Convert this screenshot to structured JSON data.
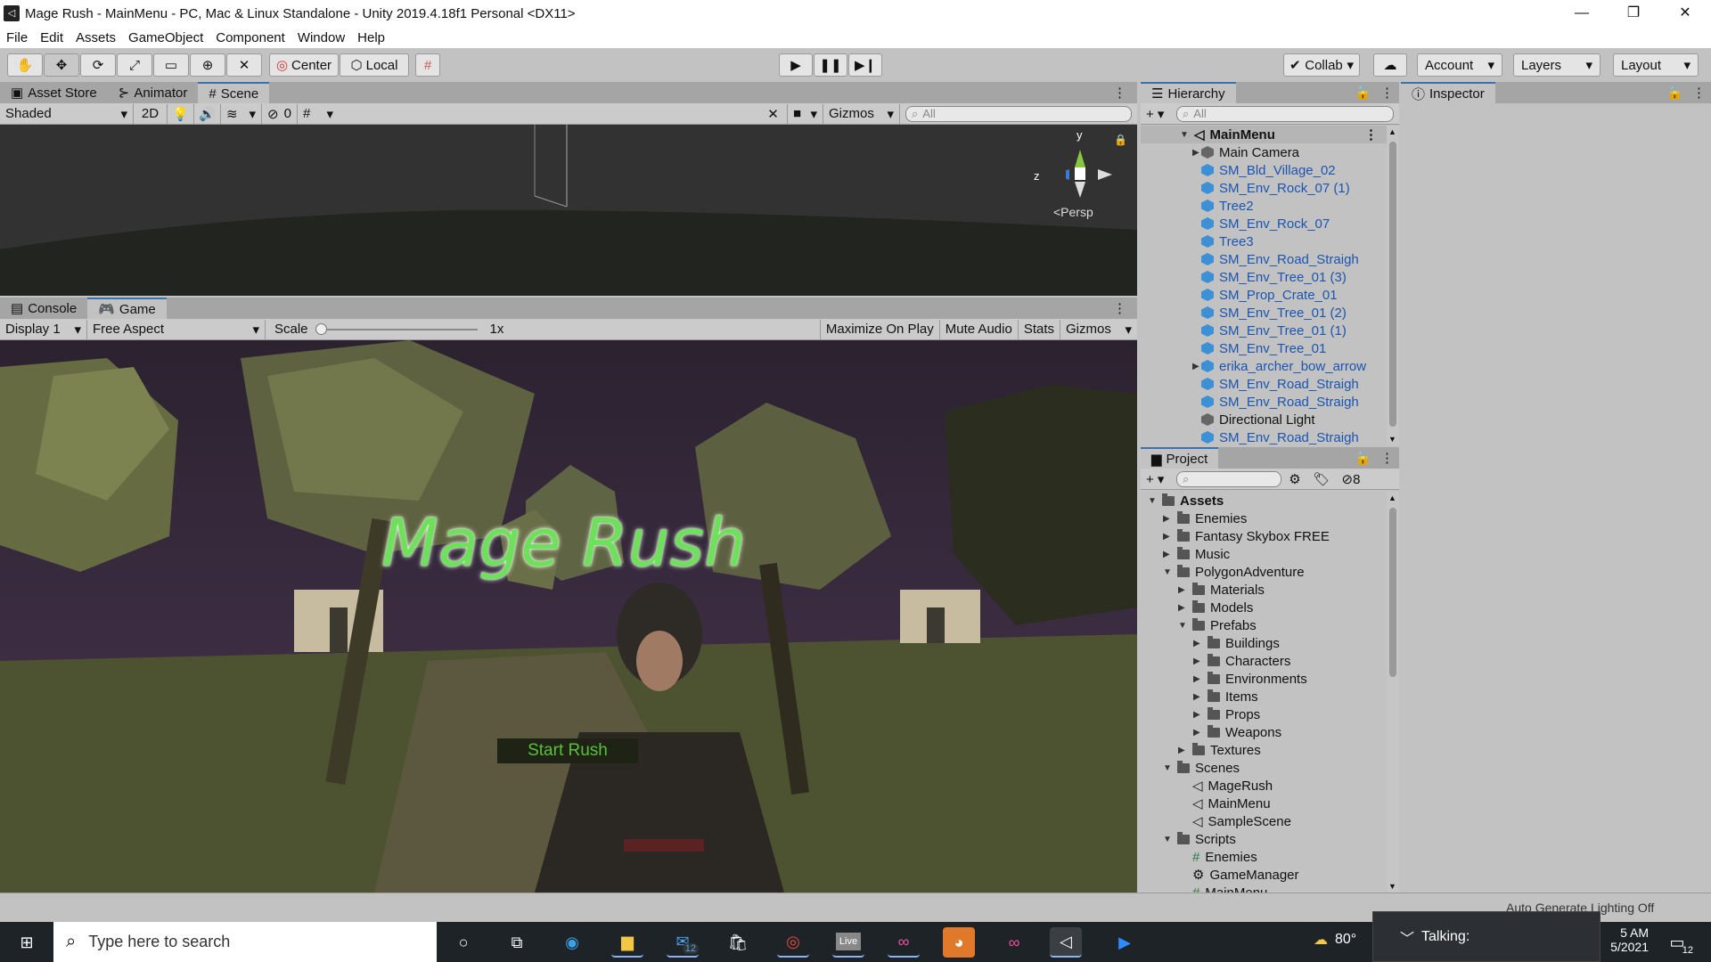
{
  "window": {
    "title": "Mage Rush - MainMenu - PC, Mac & Linux Standalone - Unity 2019.4.18f1 Personal <DX11>",
    "minimize": "—",
    "maximize": "❐",
    "close": "✕"
  },
  "menu": [
    "File",
    "Edit",
    "Assets",
    "GameObject",
    "Component",
    "Window",
    "Help"
  ],
  "toolbar": {
    "center_label": "Center",
    "local_label": "Local",
    "collab_label": "Collab",
    "account_label": "Account",
    "layers_label": "Layers",
    "layout_label": "Layout"
  },
  "scene_panel": {
    "tabs": [
      "Asset Store",
      "Animator",
      "Scene"
    ],
    "shading": "Shaded",
    "mode_2d": "2D",
    "hidden_count": "0",
    "gizmos": "Gizmos",
    "search_placeholder": "All",
    "persp": "<Persp",
    "axis_y": "y",
    "axis_z": "z"
  },
  "game_panel": {
    "tabs": [
      "Console",
      "Game"
    ],
    "display": "Display 1",
    "aspect": "Free Aspect",
    "scale_label": "Scale",
    "scale_value": "1x",
    "maximize_on_play": "Maximize On Play",
    "mute_audio": "Mute Audio",
    "stats": "Stats",
    "gizmos": "Gizmos",
    "game_title": "Mage Rush",
    "start_button": "Start Rush"
  },
  "hierarchy": {
    "tab": "Hierarchy",
    "search_placeholder": "All",
    "scene": "MainMenu",
    "items": [
      {
        "name": "Main Camera",
        "type": "grey"
      },
      {
        "name": "SM_Bld_Village_02",
        "type": "prefab"
      },
      {
        "name": "SM_Env_Rock_07 (1)",
        "type": "prefab"
      },
      {
        "name": "Tree2",
        "type": "prefab"
      },
      {
        "name": "SM_Env_Rock_07",
        "type": "prefab"
      },
      {
        "name": "Tree3",
        "type": "prefab"
      },
      {
        "name": "SM_Env_Road_Straigh",
        "type": "prefab"
      },
      {
        "name": "SM_Env_Tree_01 (3)",
        "type": "prefab"
      },
      {
        "name": "SM_Prop_Crate_01",
        "type": "prefab"
      },
      {
        "name": "SM_Env_Tree_01 (2)",
        "type": "prefab"
      },
      {
        "name": "SM_Env_Tree_01 (1)",
        "type": "prefab"
      },
      {
        "name": "SM_Env_Tree_01",
        "type": "prefab"
      },
      {
        "name": "erika_archer_bow_arrow",
        "type": "prefab"
      },
      {
        "name": "SM_Env_Road_Straigh",
        "type": "prefab"
      },
      {
        "name": "SM_Env_Road_Straigh",
        "type": "prefab"
      },
      {
        "name": "Directional Light",
        "type": "grey"
      },
      {
        "name": "SM_Env_Road_Straigh",
        "type": "prefab"
      }
    ]
  },
  "inspector": {
    "tab": "Inspector"
  },
  "project": {
    "tab": "Project",
    "hidden_count": "8",
    "tree": [
      {
        "label": "Assets",
        "depth": 0,
        "open": true,
        "kind": "folder",
        "bold": true
      },
      {
        "label": "Enemies",
        "depth": 1,
        "open": false,
        "kind": "folder"
      },
      {
        "label": "Fantasy Skybox FREE",
        "depth": 1,
        "open": false,
        "kind": "folder"
      },
      {
        "label": "Music",
        "depth": 1,
        "open": false,
        "kind": "folder"
      },
      {
        "label": "PolygonAdventure",
        "depth": 1,
        "open": true,
        "kind": "folder"
      },
      {
        "label": "Materials",
        "depth": 2,
        "open": false,
        "kind": "folder"
      },
      {
        "label": "Models",
        "depth": 2,
        "open": false,
        "kind": "folder"
      },
      {
        "label": "Prefabs",
        "depth": 2,
        "open": true,
        "kind": "folder"
      },
      {
        "label": "Buildings",
        "depth": 3,
        "open": false,
        "kind": "folder"
      },
      {
        "label": "Characters",
        "depth": 3,
        "open": false,
        "kind": "folder"
      },
      {
        "label": "Environments",
        "depth": 3,
        "open": false,
        "kind": "folder"
      },
      {
        "label": "Items",
        "depth": 3,
        "open": false,
        "kind": "folder"
      },
      {
        "label": "Props",
        "depth": 3,
        "open": false,
        "kind": "folder"
      },
      {
        "label": "Weapons",
        "depth": 3,
        "open": false,
        "kind": "folder"
      },
      {
        "label": "Textures",
        "depth": 2,
        "open": false,
        "kind": "folder"
      },
      {
        "label": "Scenes",
        "depth": 1,
        "open": true,
        "kind": "folder"
      },
      {
        "label": "MageRush",
        "depth": 2,
        "open": null,
        "kind": "scene"
      },
      {
        "label": "MainMenu",
        "depth": 2,
        "open": null,
        "kind": "scene"
      },
      {
        "label": "SampleScene",
        "depth": 2,
        "open": null,
        "kind": "scene"
      },
      {
        "label": "Scripts",
        "depth": 1,
        "open": true,
        "kind": "folder"
      },
      {
        "label": "Enemies",
        "depth": 2,
        "open": null,
        "kind": "script"
      },
      {
        "label": "GameManager",
        "depth": 2,
        "open": null,
        "kind": "gear"
      },
      {
        "label": "MainMenu",
        "depth": 2,
        "open": null,
        "kind": "script"
      }
    ]
  },
  "status": {
    "lighting": "Auto Generate Lighting Off"
  },
  "taskbar": {
    "search_placeholder": "Type here to search",
    "mail_badge": "12",
    "weather": "80°",
    "talking": "Talking:",
    "time": "5 AM",
    "date": "5/2021",
    "notif_badge": "12",
    "live_label": "Live"
  }
}
